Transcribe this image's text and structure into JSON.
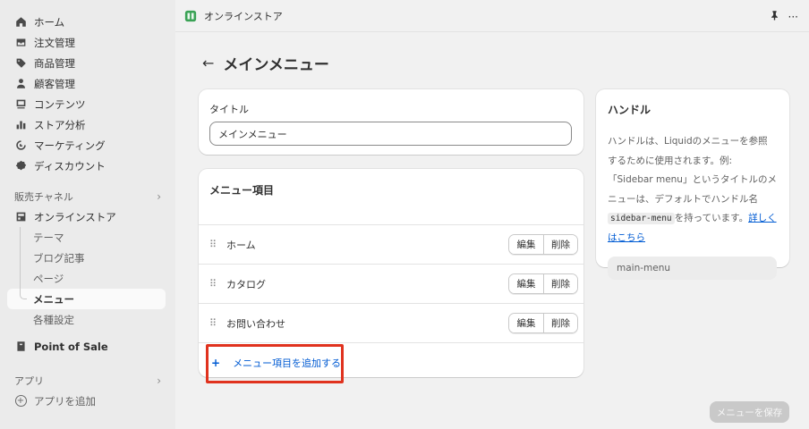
{
  "sidebar": {
    "nav": [
      {
        "label": "ホーム",
        "icon": "home-icon"
      },
      {
        "label": "注文管理",
        "icon": "inbox-icon"
      },
      {
        "label": "商品管理",
        "icon": "tag-icon"
      },
      {
        "label": "顧客管理",
        "icon": "person-icon"
      },
      {
        "label": "コンテンツ",
        "icon": "content-icon"
      },
      {
        "label": "ストア分析",
        "icon": "bar-chart-icon"
      },
      {
        "label": "マーケティング",
        "icon": "target-icon"
      },
      {
        "label": "ディスカウント",
        "icon": "discount-icon"
      }
    ],
    "sales_channels_label": "販売チャネル",
    "online_store_label": "オンラインストア",
    "sub_items": [
      "テーマ",
      "ブログ記事",
      "ページ",
      "メニュー",
      "各種設定"
    ],
    "pos_label": "Point of Sale",
    "apps_label": "アプリ",
    "add_app_label": "アプリを追加"
  },
  "topbar": {
    "store_name": "オンラインストア",
    "more": "···"
  },
  "page": {
    "back": "←",
    "title": "メインメニュー"
  },
  "title_card": {
    "label": "タイトル",
    "value": "メインメニュー"
  },
  "menu_card": {
    "heading": "メニュー項目",
    "items": [
      "ホーム",
      "カタログ",
      "お問い合わせ"
    ],
    "edit_label": "編集",
    "delete_label": "削除",
    "add_label": "メニュー項目を追加する",
    "add_plus": "+"
  },
  "handle_card": {
    "title": "ハンドル",
    "desc_before": "ハンドルは、Liquidのメニューを参照するために使用されます。例: 「Sidebar menu」というタイトルのメニューは、デフォルトでハンドル名",
    "code": "sidebar-menu",
    "desc_after": "を持っています。",
    "link": "詳しくはこちら",
    "handle_value": "main-menu"
  },
  "save_button": "メニューを保存",
  "colors": {
    "accent": "#005bd3",
    "highlight": "#e0321e"
  }
}
